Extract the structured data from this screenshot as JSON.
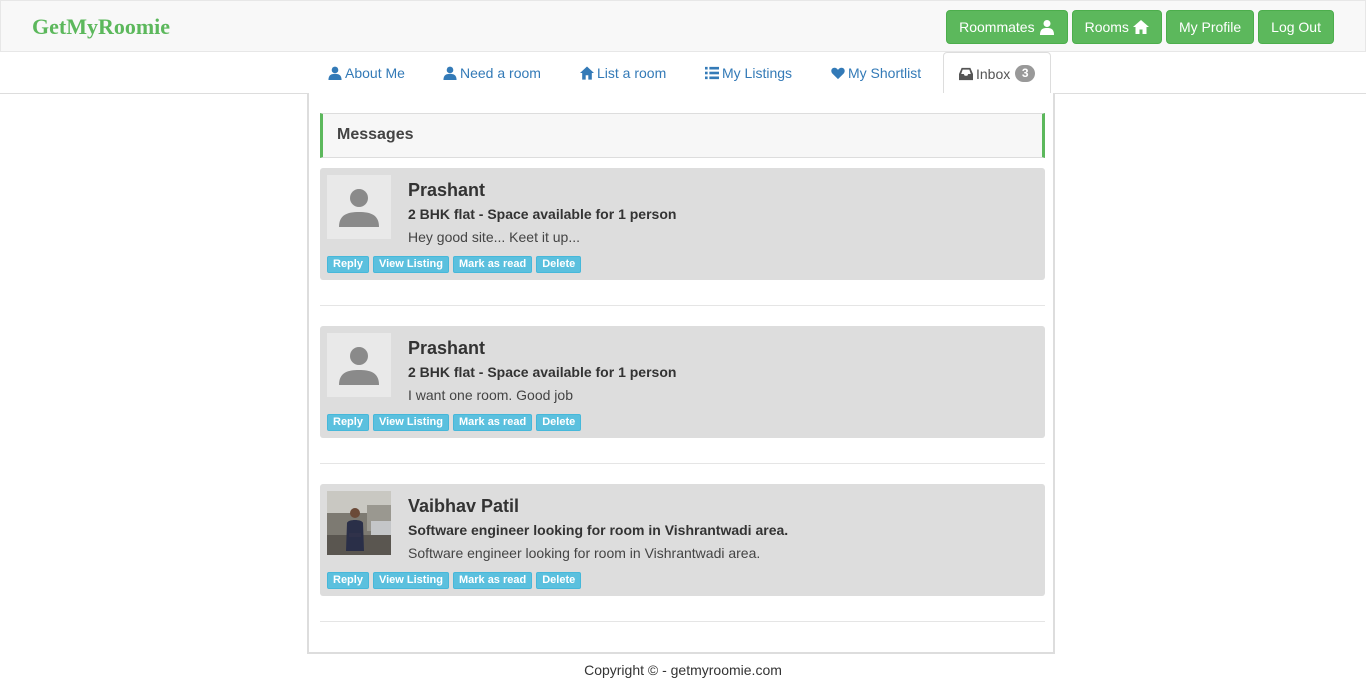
{
  "brand": "GetMyRoomie",
  "colors": {
    "brand": "#5cb85c",
    "link": "#337ab7",
    "info": "#5bc0de",
    "card_bg": "#dddddd"
  },
  "nav": {
    "roommates": "Roommates",
    "rooms": "Rooms",
    "profile": "My Profile",
    "logout": "Log Out"
  },
  "tabs": {
    "about": "About Me",
    "need_room": "Need a room",
    "list_room": "List a room",
    "listings": "My Listings",
    "shortlist": "My Shortlist",
    "inbox": "Inbox",
    "inbox_count": "3"
  },
  "messages_header": "Messages",
  "actions": {
    "reply": "Reply",
    "view_listing": "View Listing",
    "mark_read": "Mark as read",
    "delete": "Delete"
  },
  "messages": [
    {
      "sender": "Prashant",
      "subject": "2 BHK flat - Space available for 1 person",
      "preview": "Hey good site... Keet it up...",
      "avatar": "placeholder-user-icon"
    },
    {
      "sender": "Prashant",
      "subject": "2 BHK flat - Space available for 1 person",
      "preview": "I want one room. Good job",
      "avatar": "placeholder-user-icon"
    },
    {
      "sender": "Vaibhav Patil",
      "subject": "Software engineer looking for room in Vishrantwadi area.",
      "preview": "Software engineer looking for room in Vishrantwadi area.",
      "avatar": "user-photo"
    }
  ],
  "footer": "Copyright © - getmyroomie.com"
}
